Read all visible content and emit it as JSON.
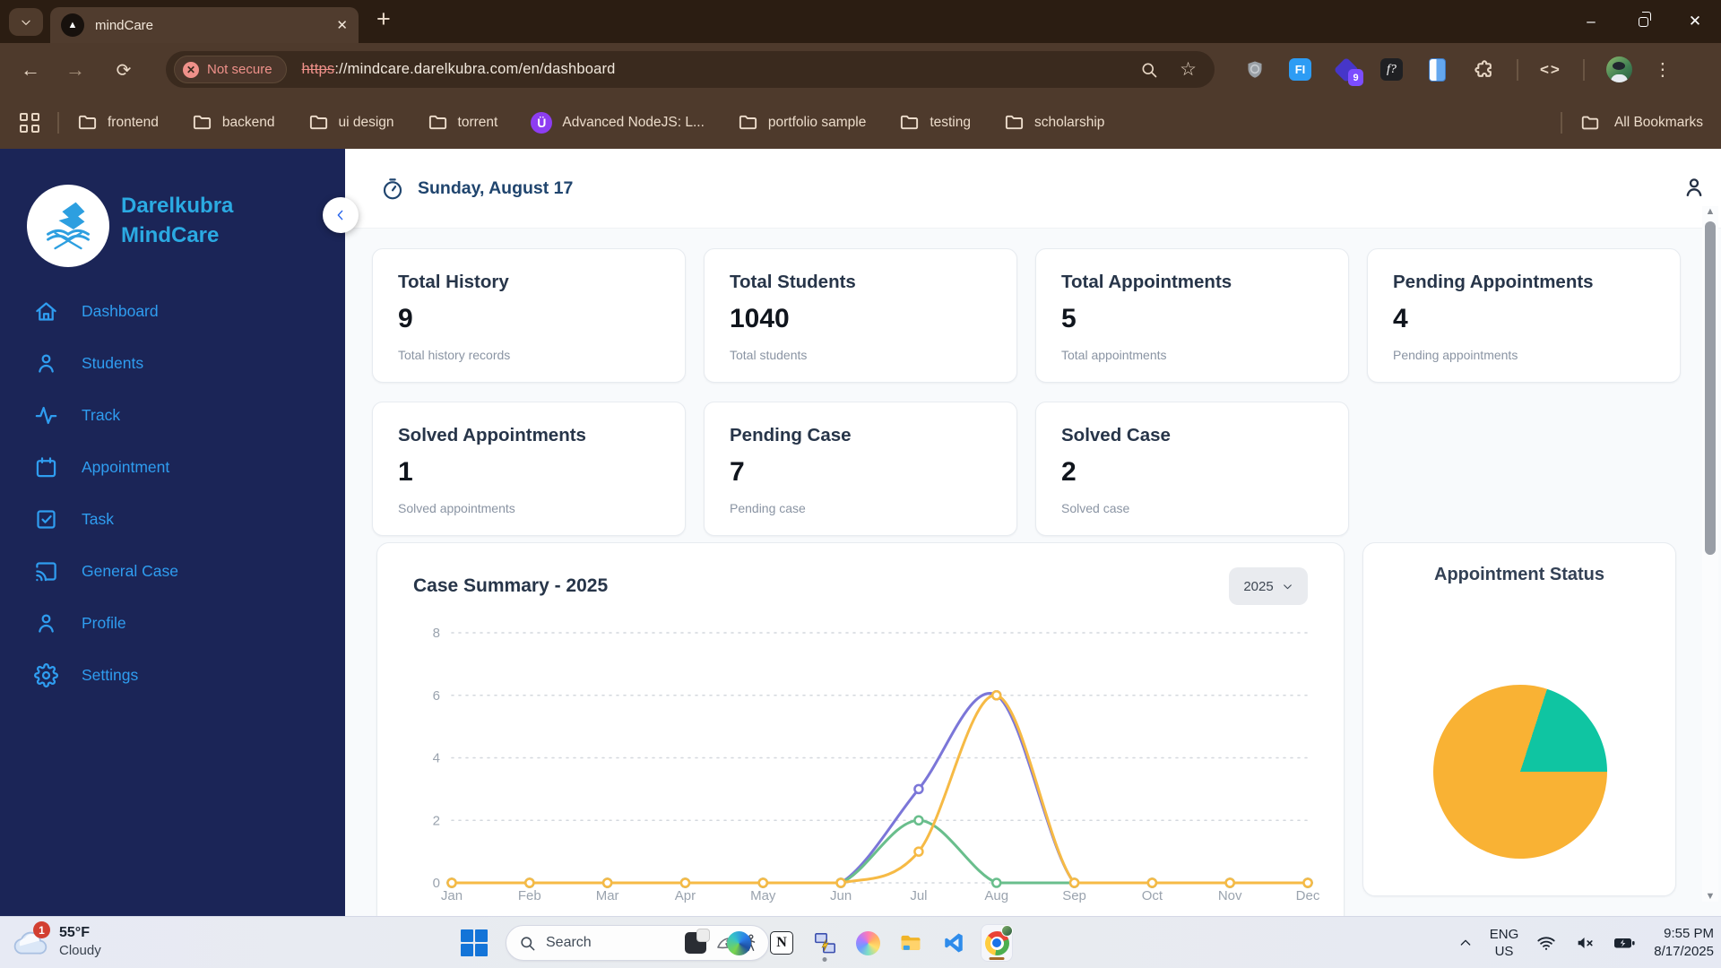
{
  "colors": {
    "sidebar_bg": "#1b2557",
    "brand_blue": "#2baae2",
    "menu_blue": "#2f9df0",
    "chrome_bg": "#4e3a2c",
    "security_warning": "#ef918a"
  },
  "glyphs": {
    "new_tab": "+",
    "close_tab": "✕",
    "minimize": "–",
    "close_window": "✕",
    "back": "←",
    "forward": "→",
    "reload": "⟳",
    "star": "☆",
    "code": "<>",
    "menu_dots": "⋮",
    "scroll_up": "▲",
    "scroll_down": "▼",
    "favicon_triangle": "▲"
  },
  "browser": {
    "tab_title": "mindCare",
    "security_label": "Not secure",
    "url_struck": "https",
    "url_rest": "://mindcare.darelkubra.com/en/dashboard",
    "extension_badge": "9",
    "fi_extension_label": "FI",
    "f_question_label": "f?",
    "u_site_letter": "Ü",
    "bookmarks": [
      {
        "label": "frontend",
        "icon": "folder-icon"
      },
      {
        "label": "backend",
        "icon": "folder-icon"
      },
      {
        "label": "ui design",
        "icon": "folder-icon"
      },
      {
        "label": "torrent",
        "icon": "folder-icon"
      },
      {
        "label": "Advanced NodeJS: L...",
        "icon": "u-umlaut-site-icon"
      },
      {
        "label": "portfolio sample",
        "icon": "folder-icon"
      },
      {
        "label": "testing",
        "icon": "folder-icon"
      },
      {
        "label": "scholarship",
        "icon": "folder-icon"
      }
    ],
    "all_bookmarks": "All Bookmarks"
  },
  "sidebar": {
    "brand1": "Darelkubra",
    "brand2": "MindCare",
    "items": [
      {
        "label": "Dashboard",
        "icon": "home-icon"
      },
      {
        "label": "Students",
        "icon": "person-icon"
      },
      {
        "label": "Track",
        "icon": "activity-icon"
      },
      {
        "label": "Appointment",
        "icon": "calendar-icon"
      },
      {
        "label": "Task",
        "icon": "task-check-icon"
      },
      {
        "label": "General Case",
        "icon": "cast-icon"
      },
      {
        "label": "Profile",
        "icon": "person-icon"
      },
      {
        "label": "Settings",
        "icon": "gear-icon"
      }
    ]
  },
  "header": {
    "date": "Sunday, August 17"
  },
  "stat_cards": {
    "row1": [
      {
        "title": "Total History",
        "value": "9",
        "subtitle": "Total history records"
      },
      {
        "title": "Total Students",
        "value": "1040",
        "subtitle": "Total students"
      },
      {
        "title": "Total Appointments",
        "value": "5",
        "subtitle": "Total appointments"
      },
      {
        "title": "Pending Appointments",
        "value": "4",
        "subtitle": "Pending appointments"
      }
    ],
    "row2": [
      {
        "title": "Solved Appointments",
        "value": "1",
        "subtitle": "Solved appointments"
      },
      {
        "title": "Pending Case",
        "value": "7",
        "subtitle": "Pending case"
      },
      {
        "title": "Solved Case",
        "value": "2",
        "subtitle": "Solved case"
      }
    ]
  },
  "case_summary": {
    "year": "2025"
  },
  "chart_data": [
    {
      "type": "line",
      "title": "Case Summary - 2025",
      "x": [
        "Jan",
        "Feb",
        "Mar",
        "Apr",
        "May",
        "Jun",
        "Jul",
        "Aug",
        "Sep",
        "Oct",
        "Nov",
        "Dec"
      ],
      "ylim": [
        0,
        8
      ],
      "yticks": [
        0,
        2,
        4,
        6,
        8
      ],
      "grid": "dashed-horizontal",
      "legend": "none",
      "series": [
        {
          "name": "indigo-series",
          "color": "#7b76d8",
          "values": [
            0,
            0,
            0,
            0,
            0,
            0,
            3,
            6,
            0,
            0,
            0,
            0
          ]
        },
        {
          "name": "green-series",
          "color": "#69be8c",
          "values": [
            0,
            0,
            0,
            0,
            0,
            0,
            2,
            0,
            0,
            0,
            0,
            0
          ]
        },
        {
          "name": "yellow-series",
          "color": "#f6ba45",
          "values": [
            0,
            0,
            0,
            0,
            0,
            0,
            1,
            6,
            0,
            0,
            0,
            0
          ]
        }
      ]
    },
    {
      "type": "pie",
      "title": "Appointment Status",
      "slices": [
        {
          "label": "solved",
          "value": 1,
          "color": "#0fc5a2"
        },
        {
          "label": "pending",
          "value": 4,
          "color": "#f9b234"
        }
      ],
      "start_angle_deg": 18,
      "legend": "none"
    }
  ],
  "taskbar": {
    "weather_badge": "1",
    "weather_temp": "55°F",
    "weather_desc": "Cloudy",
    "search_label": "Search",
    "apps": [
      "widgets",
      "edge",
      "notion",
      "remote-desktop",
      "copilot",
      "file-explorer",
      "vscode",
      "chrome"
    ],
    "tray": {
      "lang_line1": "ENG",
      "lang_line2": "US",
      "time": "9:55 PM",
      "date": "8/17/2025"
    }
  }
}
